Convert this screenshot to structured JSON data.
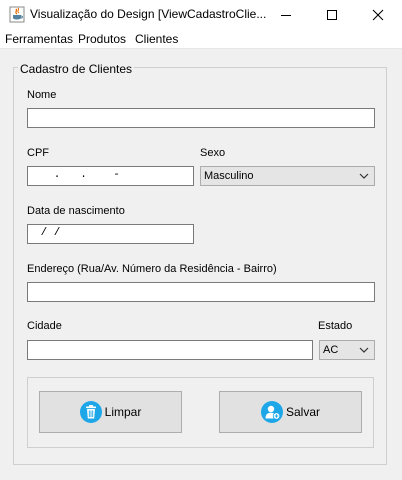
{
  "window": {
    "title": "Visualização do Design [ViewCadastroClie...",
    "app_icon": "java-cup-icon",
    "controls": [
      "minimize-icon",
      "maximize-icon",
      "close-icon"
    ]
  },
  "menu": {
    "items": [
      "Ferramentas",
      "Produtos",
      "Clientes"
    ]
  },
  "form": {
    "panel_title": "Cadastro de Clientes",
    "nome": {
      "label": "Nome",
      "value": ""
    },
    "cpf": {
      "label": "CPF",
      "value": "   .   .    -"
    },
    "sexo": {
      "label": "Sexo",
      "value": "Masculino"
    },
    "data_nascimento": {
      "label": "Data de nascimento",
      "value": " / /"
    },
    "endereco": {
      "label": "Endereço (Rua/Av. Número da Residência - Bairro)",
      "value": ""
    },
    "cidade": {
      "label": "Cidade",
      "value": ""
    },
    "estado": {
      "label": "Estado",
      "value": "AC"
    }
  },
  "buttons": {
    "limpar": {
      "label": "Limpar",
      "icon": "trash-icon"
    },
    "salvar": {
      "label": "Salvar",
      "icon": "add-user-icon"
    }
  },
  "colors": {
    "window_bg": "#f0f0f0",
    "button_icon": "#1ea7e8"
  }
}
